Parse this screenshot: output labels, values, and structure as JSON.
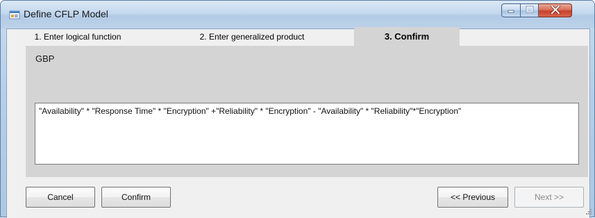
{
  "window": {
    "title": "Define CFLP Model",
    "icons": {
      "app": "form-window-icon",
      "minimize": "minimize-icon",
      "maximize": "maximize-icon",
      "close": "close-icon"
    }
  },
  "tabs": [
    {
      "label": "1. Enter logical function",
      "selected": false
    },
    {
      "label": "2. Enter generalized product",
      "selected": false
    },
    {
      "label": "3. Confirm",
      "selected": true
    }
  ],
  "confirm_page": {
    "gbp_label": "GBP",
    "gbp_expression": "\"Availability\" * \"Response Time\" * \"Encryption\" +\"Reliability\" * \"Encryption\" - \"Availability\" * \"Reliability\"*\"Encryption\""
  },
  "buttons": {
    "cancel": "Cancel",
    "confirm": "Confirm",
    "previous": "<< Previous",
    "next": "Next >>",
    "next_enabled": false
  },
  "colors": {
    "title_bar": "#c4d8ee",
    "close_button": "#c6402a",
    "tab_page": "#d4d4d4",
    "dialog_background": "#f0f0f0"
  }
}
